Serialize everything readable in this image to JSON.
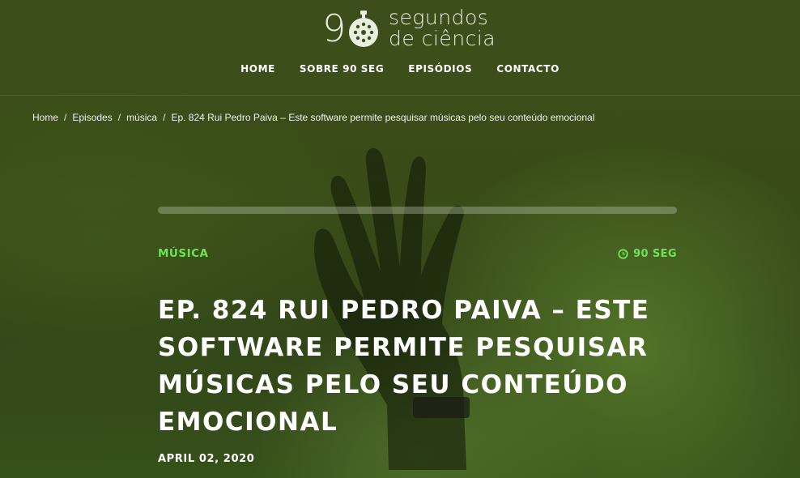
{
  "site": {
    "logo_number": "9",
    "logo_line1": "segundos",
    "logo_line2": "de ciência"
  },
  "nav": {
    "items": [
      {
        "label": "HOME"
      },
      {
        "label": "SOBRE 90 SEG"
      },
      {
        "label": "EPISÓDIOS"
      },
      {
        "label": "CONTACTO"
      }
    ]
  },
  "breadcrumb": {
    "items": [
      {
        "label": "Home"
      },
      {
        "label": "Episodes"
      },
      {
        "label": "música"
      }
    ],
    "current": "Ep. 824 Rui Pedro Paiva – Este software permite pesquisar músicas pelo seu conteúdo emocional",
    "separator": "/"
  },
  "player": {
    "progress": 0
  },
  "episode": {
    "category": "MÚSICA",
    "duration": "90 SEG",
    "title": "EP. 824 RUI PEDRO PAIVA – ESTE SOFTWARE PERMITE PESQUISAR MÚSICAS PELO SEU CONTEÚDO EMOCIONAL",
    "date": "APRIL 02, 2020"
  },
  "colors": {
    "accent": "#6ee35a",
    "background": "#3c5019"
  }
}
